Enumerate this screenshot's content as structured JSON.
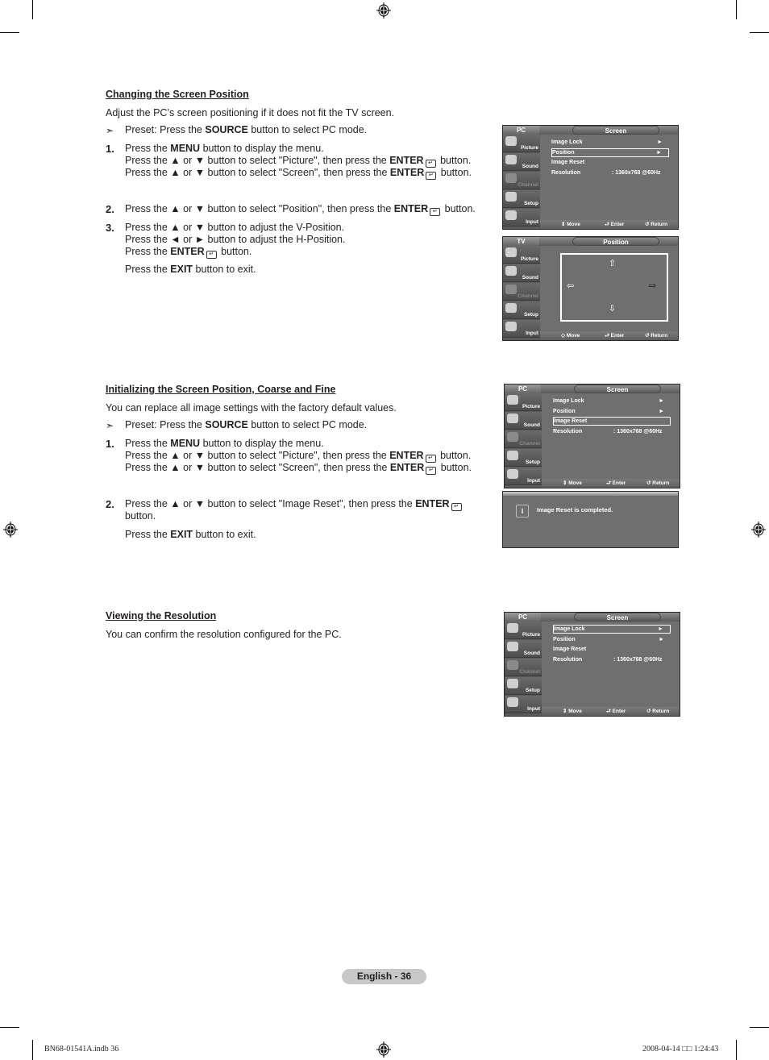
{
  "sections": [
    {
      "heading": "Changing the Screen Position",
      "intro": "Adjust the PC’s screen positioning if it does not fit the TV screen.",
      "preset": {
        "pre": "Preset: Press the ",
        "bold": "SOURCE",
        "post": " button to select PC mode."
      },
      "steps": [
        {
          "num": "1.",
          "lines": [
            [
              "Press the ",
              {
                "b": "MENU"
              },
              " button to display the menu."
            ],
            [
              "Press the ▲ or ▼ button to select \"Picture\", then press the ",
              {
                "b": "ENTER"
              },
              {
                "enter": true
              },
              " button."
            ],
            [
              "Press the ▲ or ▼ button to select \"Screen\", then press the ",
              {
                "b": "ENTER"
              },
              {
                "enter": true
              },
              " button."
            ]
          ]
        },
        {
          "num": "2.",
          "lines": [
            [
              "Press the ▲ or ▼ button to select \"Position\", then press the ",
              {
                "b": "ENTER"
              },
              {
                "enter": true
              },
              " button."
            ]
          ]
        },
        {
          "num": "3.",
          "lines": [
            [
              "Press the ▲ or ▼ button to adjust the V-Position."
            ],
            [
              "Press the ◄ or ► button to adjust the H-Position."
            ],
            [
              "Press the ",
              {
                "b": "ENTER"
              },
              {
                "enter": true
              },
              " button."
            ]
          ]
        }
      ],
      "exit": {
        "pre": "Press the ",
        "bold": "EXIT",
        "post": " button to exit."
      }
    },
    {
      "heading": "Initializing the Screen Position, Coarse and Fine",
      "intro": "You can replace all image settings with the factory default values.",
      "preset": {
        "pre": "Preset: Press the ",
        "bold": "SOURCE",
        "post": " button to select PC mode."
      },
      "steps": [
        {
          "num": "1.",
          "lines": [
            [
              "Press the ",
              {
                "b": "MENU"
              },
              " button to display the menu."
            ],
            [
              "Press the ▲ or ▼ button to select \"Picture\", then press the ",
              {
                "b": "ENTER"
              },
              {
                "enter": true
              },
              " button."
            ],
            [
              "Press the ▲ or ▼ button to select \"Screen\", then press the ",
              {
                "b": "ENTER"
              },
              {
                "enter": true
              },
              " button."
            ]
          ]
        },
        {
          "num": "2.",
          "lines": [
            [
              "Press the ▲ or ▼ button to select \"Image Reset\", then press the ",
              {
                "b": "ENTER"
              },
              {
                "enter": true
              }
            ],
            [
              "button."
            ]
          ]
        }
      ],
      "exit": {
        "pre": "Press the ",
        "bold": "EXIT",
        "post": " button to exit."
      }
    },
    {
      "heading": "Viewing the Resolution",
      "intro": "You can confirm the resolution configured for the PC."
    }
  ],
  "osd_sidebar": [
    "Picture",
    "Sound",
    "Channel",
    "Setup",
    "Input"
  ],
  "osd_footer": {
    "move": "Move",
    "enter": "Enter",
    "return": "Return"
  },
  "osd_screens": [
    {
      "mode": "PC",
      "title": "Screen",
      "selected": 1
    },
    {
      "mode": "TV",
      "title": "Position"
    },
    {
      "mode": "PC",
      "title": "Screen",
      "selected": 2
    },
    {
      "mode": "PC",
      "title": "Screen",
      "selected": 0
    }
  ],
  "screen_menu": [
    {
      "label": "Image Lock",
      "value": "",
      "arrow": "►"
    },
    {
      "label": "Position",
      "value": "",
      "arrow": "►"
    },
    {
      "label": "Image Reset",
      "value": "",
      "arrow": ""
    },
    {
      "label": "Resolution",
      "value": ": 1360x768 @60Hz",
      "arrow": ""
    }
  ],
  "popup": {
    "message": "Image Reset is completed.",
    "icon": "info-icon"
  },
  "footer": {
    "page_label": "English - 36",
    "slug_left": "BN68-01541A.indb   36",
    "slug_right": "2008-04-14   □□ 1:24:43"
  }
}
